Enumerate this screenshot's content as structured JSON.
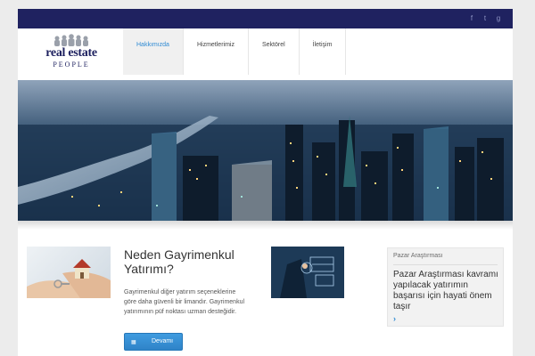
{
  "social": [
    "f",
    "t",
    "g"
  ],
  "logo": {
    "brand": "real estate",
    "sub": "PEOPLE"
  },
  "nav": [
    {
      "label": "Hakkımızda",
      "active": true
    },
    {
      "label": "Hizmetlerimiz"
    },
    {
      "label": "Sektörel"
    },
    {
      "label": "İletişim"
    }
  ],
  "hero": {
    "image": "city-skyline-night-aerial"
  },
  "content": {
    "title": "Neden Gayrimenkul Yatırımı?",
    "description": "Gayrimenkul diğer yatırım seçeneklerine göre daha güvenli bir limandır. Gayrimenkul yatırımının püf noktası uzman desteğidir.",
    "button_icon": "grid-icon",
    "button_label": "Devamı",
    "thumb1": "hand-holding-house-and-keys",
    "thumb2": "businessman-touchscreen"
  },
  "widget": {
    "title": "Pazar Araştırması",
    "text": "Pazar Araştırması kavramı yapılacak yatırımın başarısı için hayati önem taşır",
    "arrow": "›"
  },
  "colors": {
    "topbar": "#1f2260",
    "accent": "#2e8ad3",
    "button": "#2f83c8"
  }
}
